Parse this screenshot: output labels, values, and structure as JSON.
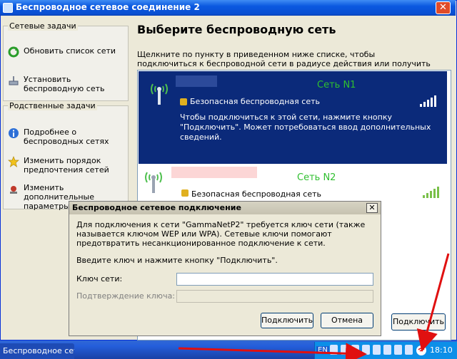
{
  "window": {
    "title": "Беспроводное сетевое соединение 2",
    "close_glyph": "✕"
  },
  "tasks_pane": {
    "title": "Сетевые задачи",
    "items": [
      {
        "label": "Обновить список сети",
        "icon": "refresh-icon"
      },
      {
        "label": "Установить беспроводную сеть",
        "icon": "setup-wireless-icon"
      }
    ]
  },
  "related_pane": {
    "title": "Родственные задачи",
    "items": [
      {
        "label": "Подробнее о беспроводных сетях",
        "icon": "info-icon"
      },
      {
        "label": "Изменить порядок предпочтения сетей",
        "icon": "star-icon"
      },
      {
        "label": "Изменить дополнительные параметры",
        "icon": "settings-icon"
      }
    ]
  },
  "main": {
    "heading": "Выберите беспроводную сеть",
    "description": "Щелкните по пункту в приведенном ниже списке, чтобы подключиться к беспроводной сети в радиусе действия или получить дополнительные сведения.",
    "networks": [
      {
        "name": "Сеть N1",
        "security": "Безопасная беспроводная сеть",
        "details": "Чтобы подключиться к этой сети, нажмите кнопку \"Подключить\". Может потребоваться ввод дополнительных сведений.",
        "signal_bars": 5,
        "selected": true
      },
      {
        "name": "Сеть N2",
        "security": "Безопасная беспроводная сеть",
        "signal_bars": 5,
        "selected": false
      }
    ],
    "connect_button": "Подключить"
  },
  "dialog": {
    "title": "Беспроводное сетевое подключение",
    "text": "Для подключения к сети \"GammaNetP2\" требуется ключ сети (также называется ключом WEP или WPA). Сетевые ключи помогают предотвратить несанкционированное подключение к сети.",
    "prompt": "Введите ключ и нажмите кнопку \"Подключить\".",
    "key_label": "Ключ сети:",
    "key_value": "",
    "confirm_label": "Подтверждение ключа:",
    "confirm_value": "",
    "connect_button": "Подключить",
    "cancel_button": "Отмена",
    "close_glyph": "✕"
  },
  "taskbar": {
    "active_window": "Беспроводное сетев...",
    "language": "EN",
    "clock": "18:10"
  },
  "colors": {
    "selected_row": "#0b2a7a",
    "network_label": "#2fbf2f",
    "arrow": "#e01010"
  }
}
